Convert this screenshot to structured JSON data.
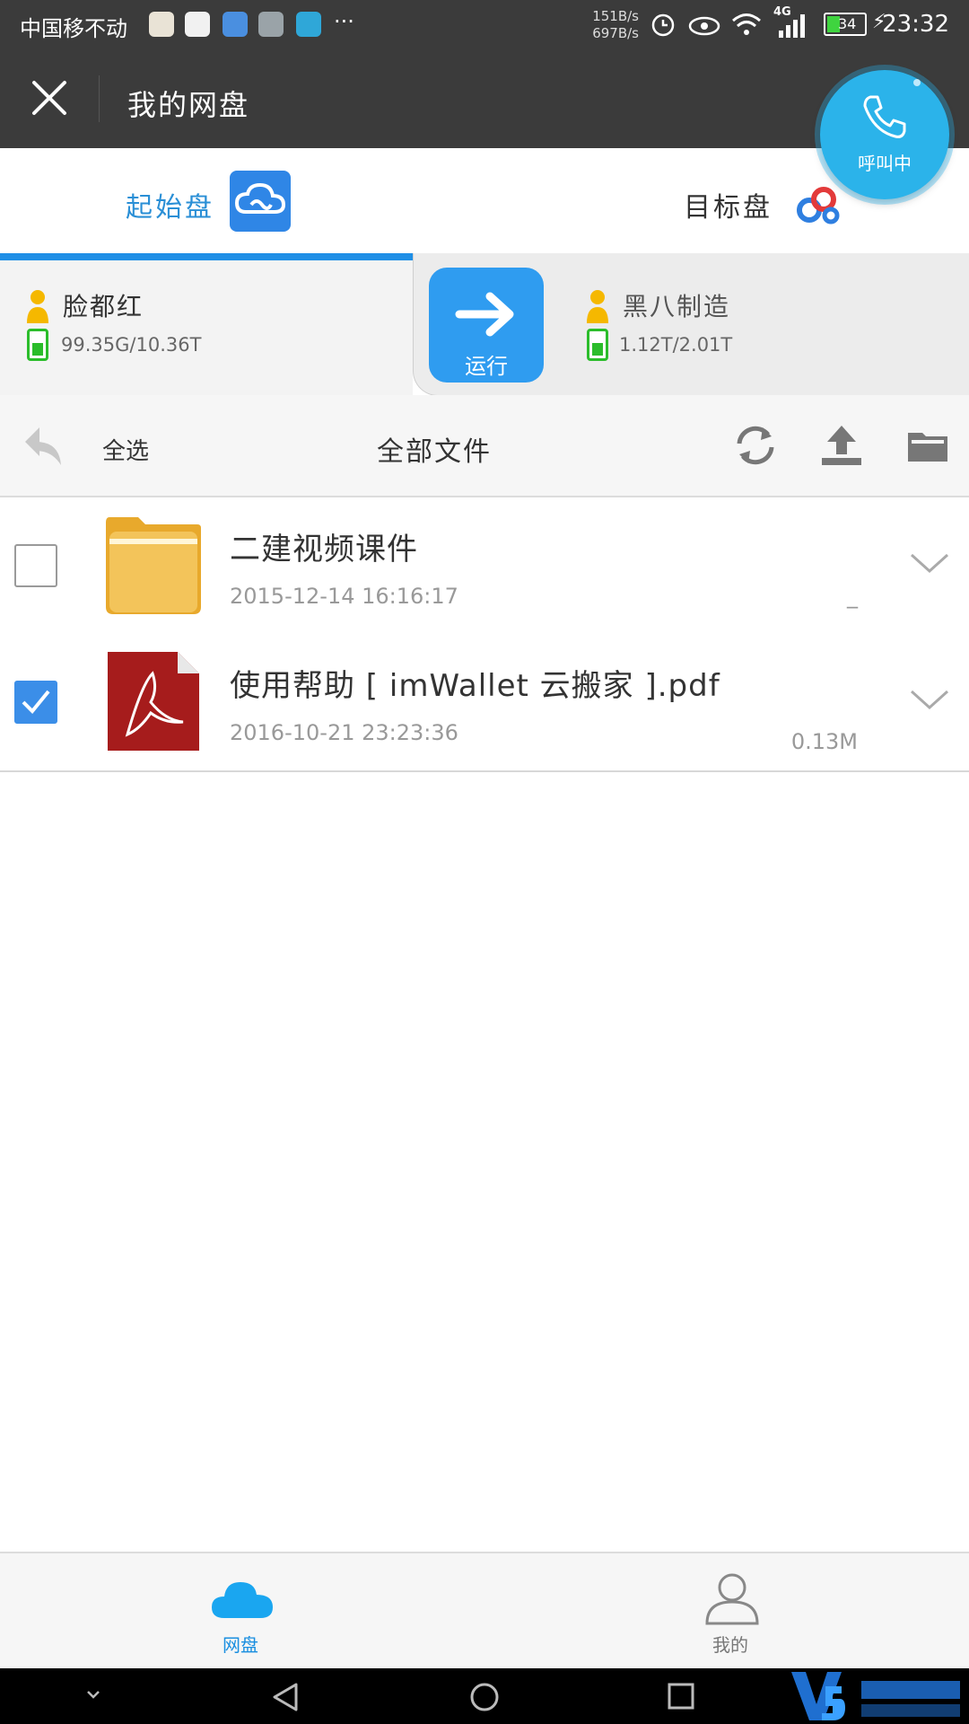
{
  "status_bar": {
    "carrier": "中国移不动",
    "speed_up": "151B/s",
    "speed_down": "697B/s",
    "network": "4G",
    "battery": "34",
    "time": "23:32",
    "more": "···"
  },
  "title_bar": {
    "title": "我的网盘"
  },
  "call_bubble": {
    "label": "呼叫中"
  },
  "disks": {
    "source_label": "起始盘",
    "target_label": "目标盘"
  },
  "transfer": {
    "source_user": "脸都红",
    "source_quota": "99.35G/10.36T",
    "run_label": "运行",
    "target_user": "黑八制造",
    "target_quota": "1.12T/2.01T"
  },
  "toolbar": {
    "select_all": "全选",
    "folder_title": "全部文件"
  },
  "files": [
    {
      "name": "二建视频课件",
      "date": "2015-12-14 16:16:17",
      "size": "_",
      "type": "folder",
      "checked": false
    },
    {
      "name": "使用帮助 [ imWallet 云搬家 ].pdf",
      "date": "2016-10-21 23:23:36",
      "size": "0.13M",
      "type": "pdf",
      "checked": true
    }
  ],
  "bottom_nav": {
    "disk_label": "网盘",
    "mine_label": "我的"
  },
  "colors": {
    "accent": "#2a8fd6",
    "dark_bar": "#3b3b3b",
    "call_blue": "#2bb3ea",
    "battery_green": "#2bbd2b"
  }
}
